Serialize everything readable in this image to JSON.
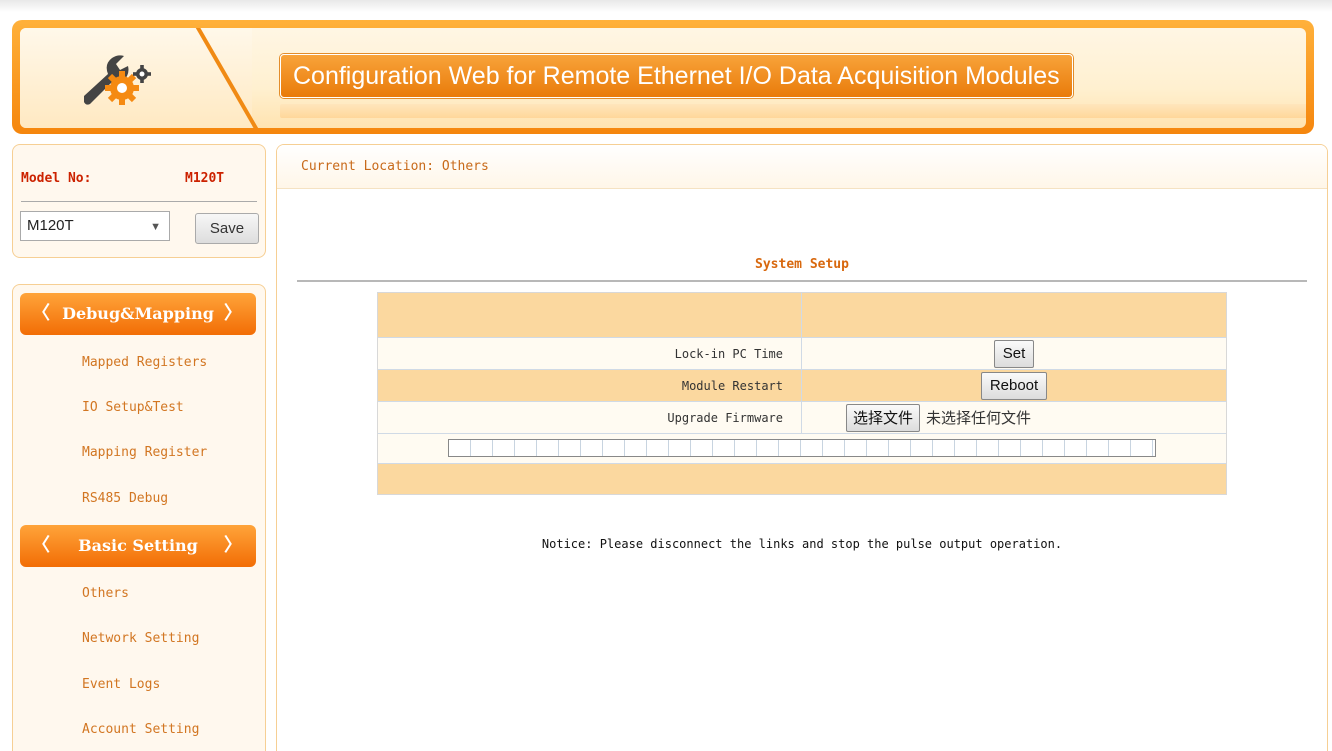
{
  "header": {
    "title": "Configuration Web for Remote Ethernet I/O Data Acquisition Modules"
  },
  "model": {
    "label": "Model No:",
    "value": "M120T",
    "select_value": "M120T",
    "save_label": "Save"
  },
  "nav": {
    "groups": [
      {
        "label": "Debug&Mapping",
        "items": [
          "Mapped Registers",
          "IO Setup&Test",
          "Mapping Register",
          "RS485 Debug"
        ]
      },
      {
        "label": "Basic Setting",
        "items": [
          "Others",
          "Network Setting",
          "Event Logs",
          "Account Setting"
        ]
      }
    ]
  },
  "main": {
    "location": "Current Location: Others",
    "section_title": "System Setup",
    "rows": {
      "lock_time": {
        "label": "Lock-in PC Time",
        "button": "Set"
      },
      "restart": {
        "label": "Module Restart",
        "button": "Reboot"
      },
      "firmware": {
        "label": "Upgrade Firmware",
        "button": "选择文件",
        "status": "未选择任何文件"
      }
    },
    "progress": 0,
    "notice": "Notice: Please disconnect the links and stop the pulse output operation."
  },
  "colors": {
    "accent": "#f5860d",
    "nav_text": "#d27622",
    "title_text": "#d8680e"
  }
}
